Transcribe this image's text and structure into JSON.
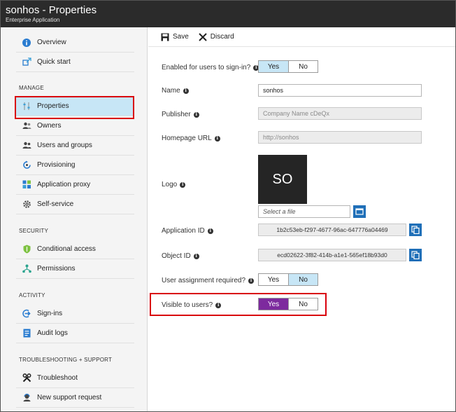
{
  "header": {
    "title": "sonhos - Properties",
    "subtitle": "Enterprise Application"
  },
  "sidebar": {
    "top_items": [
      {
        "label": "Overview"
      },
      {
        "label": "Quick start"
      }
    ],
    "sections": [
      {
        "title": "MANAGE",
        "items": [
          {
            "label": "Properties"
          },
          {
            "label": "Owners"
          },
          {
            "label": "Users and groups"
          },
          {
            "label": "Provisioning"
          },
          {
            "label": "Application proxy"
          },
          {
            "label": "Self-service"
          }
        ]
      },
      {
        "title": "SECURITY",
        "items": [
          {
            "label": "Conditional access"
          },
          {
            "label": "Permissions"
          }
        ]
      },
      {
        "title": "ACTIVITY",
        "items": [
          {
            "label": "Sign-ins"
          },
          {
            "label": "Audit logs"
          }
        ]
      },
      {
        "title": "TROUBLESHOOTING + SUPPORT",
        "items": [
          {
            "label": "Troubleshoot"
          },
          {
            "label": "New support request"
          }
        ]
      }
    ],
    "selected": "Properties"
  },
  "toolbar": {
    "save_label": "Save",
    "discard_label": "Discard"
  },
  "form": {
    "enabled": {
      "label": "Enabled for users to sign-in?",
      "yes": "Yes",
      "no": "No",
      "value": "Yes"
    },
    "name": {
      "label": "Name",
      "value": "sonhos"
    },
    "publisher": {
      "label": "Publisher",
      "value": "Company Name cDeQx"
    },
    "homepage": {
      "label": "Homepage URL",
      "value": "http://sonhos"
    },
    "logo": {
      "label": "Logo",
      "initials": "SO",
      "file_placeholder": "Select a file"
    },
    "app_id": {
      "label": "Application ID",
      "value": "1b2c53eb-f297-4677-96ac-647776a04469"
    },
    "object_id": {
      "label": "Object ID",
      "value": "ecd02622-3f82-414b-a1e1-565ef18b93d0"
    },
    "assignment": {
      "label": "User assignment required?",
      "yes": "Yes",
      "no": "No",
      "value": "No"
    },
    "visible": {
      "label": "Visible to users?",
      "yes": "Yes",
      "no": "No",
      "value": "Yes"
    }
  },
  "colors": {
    "header_bg": "#2b2b2b",
    "selected_bg": "#c7e6f6",
    "accent_blue": "#1f6fb8",
    "purple": "#7d2a9e",
    "highlight_red": "#d9000d"
  }
}
